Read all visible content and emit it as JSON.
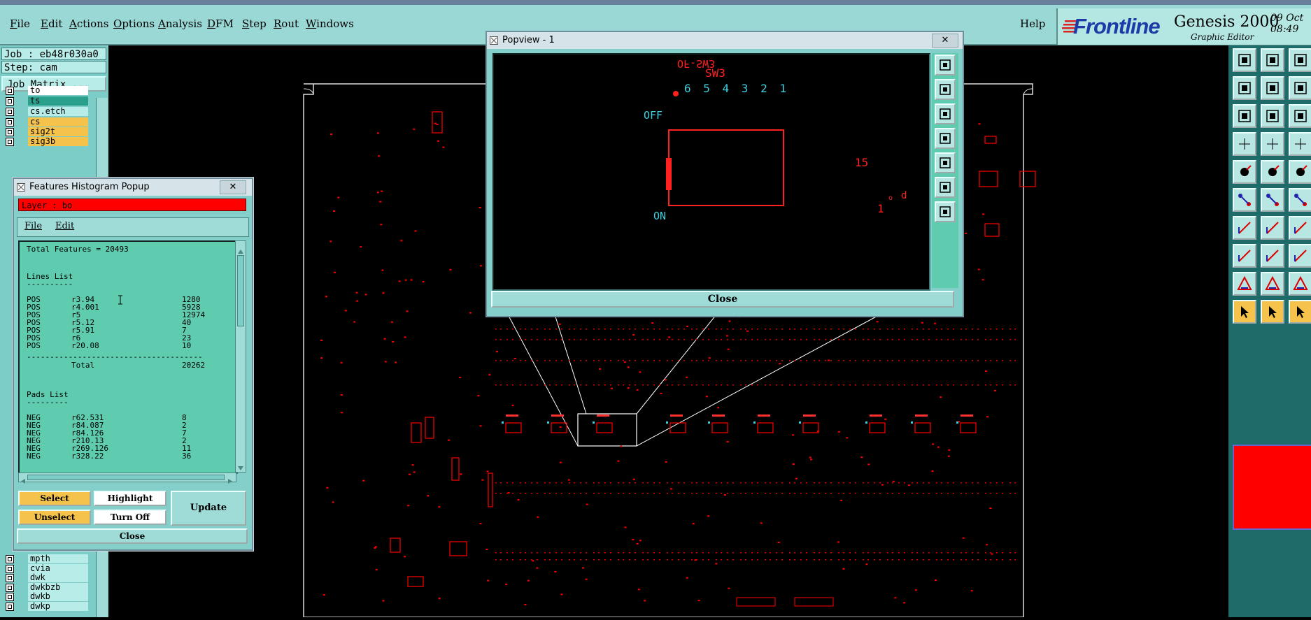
{
  "menubar": {
    "items": [
      {
        "label": "File",
        "u": "F",
        "rest": "ile"
      },
      {
        "label": "Edit",
        "u": "E",
        "rest": "dit"
      },
      {
        "label": "Actions",
        "u": "A",
        "rest": "ctions"
      },
      {
        "label": "Options",
        "u": "O",
        "rest": "ptions"
      },
      {
        "label": "Analysis",
        "u": "A",
        "rest": "nalysis"
      },
      {
        "label": "DFM",
        "u": "D",
        "rest": "FM"
      },
      {
        "label": "Step",
        "u": "S",
        "rest": "tep"
      },
      {
        "label": "Rout",
        "u": "R",
        "rest": "out"
      },
      {
        "label": "Windows",
        "u": "W",
        "rest": "indows"
      }
    ],
    "help_label": "Help"
  },
  "logo": {
    "brand": "Frontline",
    "product": "Genesis 2000",
    "subtitle": "Graphic Editor",
    "date_line1": "09 Oct",
    "date_line2": "08:49"
  },
  "left_panel": {
    "job": "Job : eb48r030a0",
    "step": "Step: cam",
    "job_matrix": "Job Matrix ...",
    "layers_top": [
      {
        "name": "to",
        "color": "#ffffff"
      },
      {
        "name": "ts",
        "color": "#2aa08c"
      },
      {
        "name": "cs.etch",
        "color": "#b8ece8"
      },
      {
        "name": "cs",
        "color": "#f5c24c"
      },
      {
        "name": "sig2t",
        "color": "#f5c24c"
      },
      {
        "name": "sig3b",
        "color": "#f5c24c"
      }
    ],
    "layers_bottom": [
      {
        "name": "mpth",
        "color": "#b8ece8"
      },
      {
        "name": "cvia",
        "color": "#b8ece8"
      },
      {
        "name": "dwk",
        "color": "#b8ece8"
      },
      {
        "name": "dwkbzb",
        "color": "#b8ece8"
      },
      {
        "name": "dwkb",
        "color": "#b8ece8"
      },
      {
        "name": "dwkp",
        "color": "#b8ece8"
      }
    ]
  },
  "histogram": {
    "title": "Features Histogram Popup",
    "close_x": "✕",
    "layer_label": "Layer :  bo",
    "menu_file": "File",
    "menu_edit": "Edit",
    "total_features": "Total Features = 20493",
    "lines_header": "Lines List",
    "lines_underline": "----------",
    "lines": [
      {
        "pol": "POS",
        "sym": "r3.94",
        "count": "1280"
      },
      {
        "pol": "POS",
        "sym": "r4.001",
        "count": "5928"
      },
      {
        "pol": "POS",
        "sym": "r5",
        "count": "12974"
      },
      {
        "pol": "POS",
        "sym": "r5.12",
        "count": "40"
      },
      {
        "pol": "POS",
        "sym": "r5.91",
        "count": "7"
      },
      {
        "pol": "POS",
        "sym": "r6",
        "count": "23"
      },
      {
        "pol": "POS",
        "sym": "r20.08",
        "count": "10"
      }
    ],
    "lines_separator": "--------------------------------------",
    "total_label": "Total",
    "lines_total": "20262",
    "pads_header": "Pads List",
    "pads_underline": "---------",
    "pads": [
      {
        "pol": "NEG",
        "sym": "r62.531",
        "count": "8"
      },
      {
        "pol": "NEG",
        "sym": "r84.087",
        "count": "2"
      },
      {
        "pol": "NEG",
        "sym": "r84.126",
        "count": "7"
      },
      {
        "pol": "NEG",
        "sym": "r210.13",
        "count": "2"
      },
      {
        "pol": "NEG",
        "sym": "r269.126",
        "count": "11"
      },
      {
        "pol": "NEG",
        "sym": "r328.22",
        "count": "36"
      }
    ],
    "buttons": {
      "select": "Select",
      "highlight": "Highlight",
      "update": "Update",
      "unselect": "Unselect",
      "turn_off": "Turn Off",
      "close": "Close"
    }
  },
  "popview": {
    "title": "Popview - 1",
    "close_x": "✕",
    "close_label": "Close",
    "texts": {
      "top_partial": "OF-SW3",
      "sw3": "SW3",
      "digits": "6 5 4 3 2 1",
      "off": "OFF",
      "on": "ON",
      "fifteen": "15",
      "d": "d",
      "o": "o",
      "one": "1"
    }
  },
  "colors": {
    "panel": "#99d8d4",
    "feature_red": "#ff0000",
    "text_cyan": "#40d0e0",
    "button_orange": "#f5c24c"
  }
}
